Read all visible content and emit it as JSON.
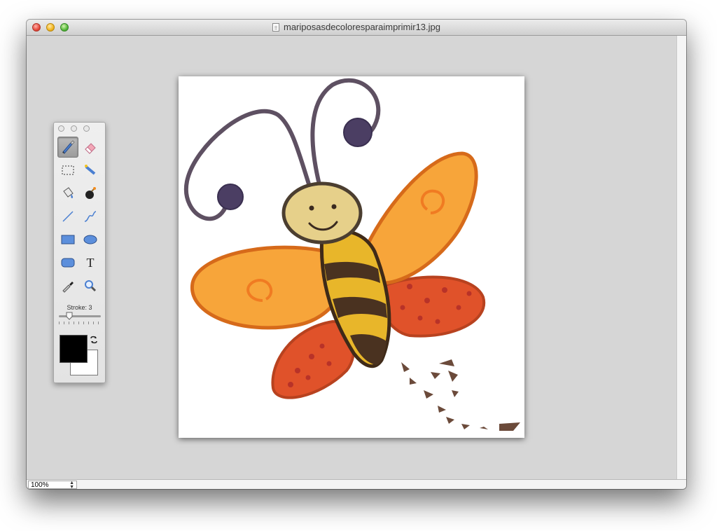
{
  "window": {
    "title": "mariposasdecoloresparaimprimir13.jpg"
  },
  "palette": {
    "tools": [
      {
        "name": "paintbrush-icon",
        "selected": true
      },
      {
        "name": "eraser-icon",
        "selected": false
      },
      {
        "name": "rectangle-select-icon",
        "selected": false
      },
      {
        "name": "magic-wand-icon",
        "selected": false
      },
      {
        "name": "paint-bucket-icon",
        "selected": false
      },
      {
        "name": "bomb-icon",
        "selected": false
      },
      {
        "name": "line-icon",
        "selected": false
      },
      {
        "name": "curve-icon",
        "selected": false
      },
      {
        "name": "rectangle-icon",
        "selected": false
      },
      {
        "name": "ellipse-icon",
        "selected": false
      },
      {
        "name": "rounded-rectangle-icon",
        "selected": false
      },
      {
        "name": "text-icon",
        "selected": false
      },
      {
        "name": "eyedropper-icon",
        "selected": false
      },
      {
        "name": "magnifier-icon",
        "selected": false
      }
    ],
    "text_tool_glyph": "T",
    "stroke_label": "Stroke: 3",
    "stroke_value": 3,
    "foreground_color": "#000000",
    "background_color": "#ffffff"
  },
  "status": {
    "zoom": "100%"
  },
  "colors": {
    "wing_orange": "#f28c1e",
    "wing_red": "#e0522a",
    "body_brown": "#4a3220",
    "antenna": "#5a4a5e"
  }
}
